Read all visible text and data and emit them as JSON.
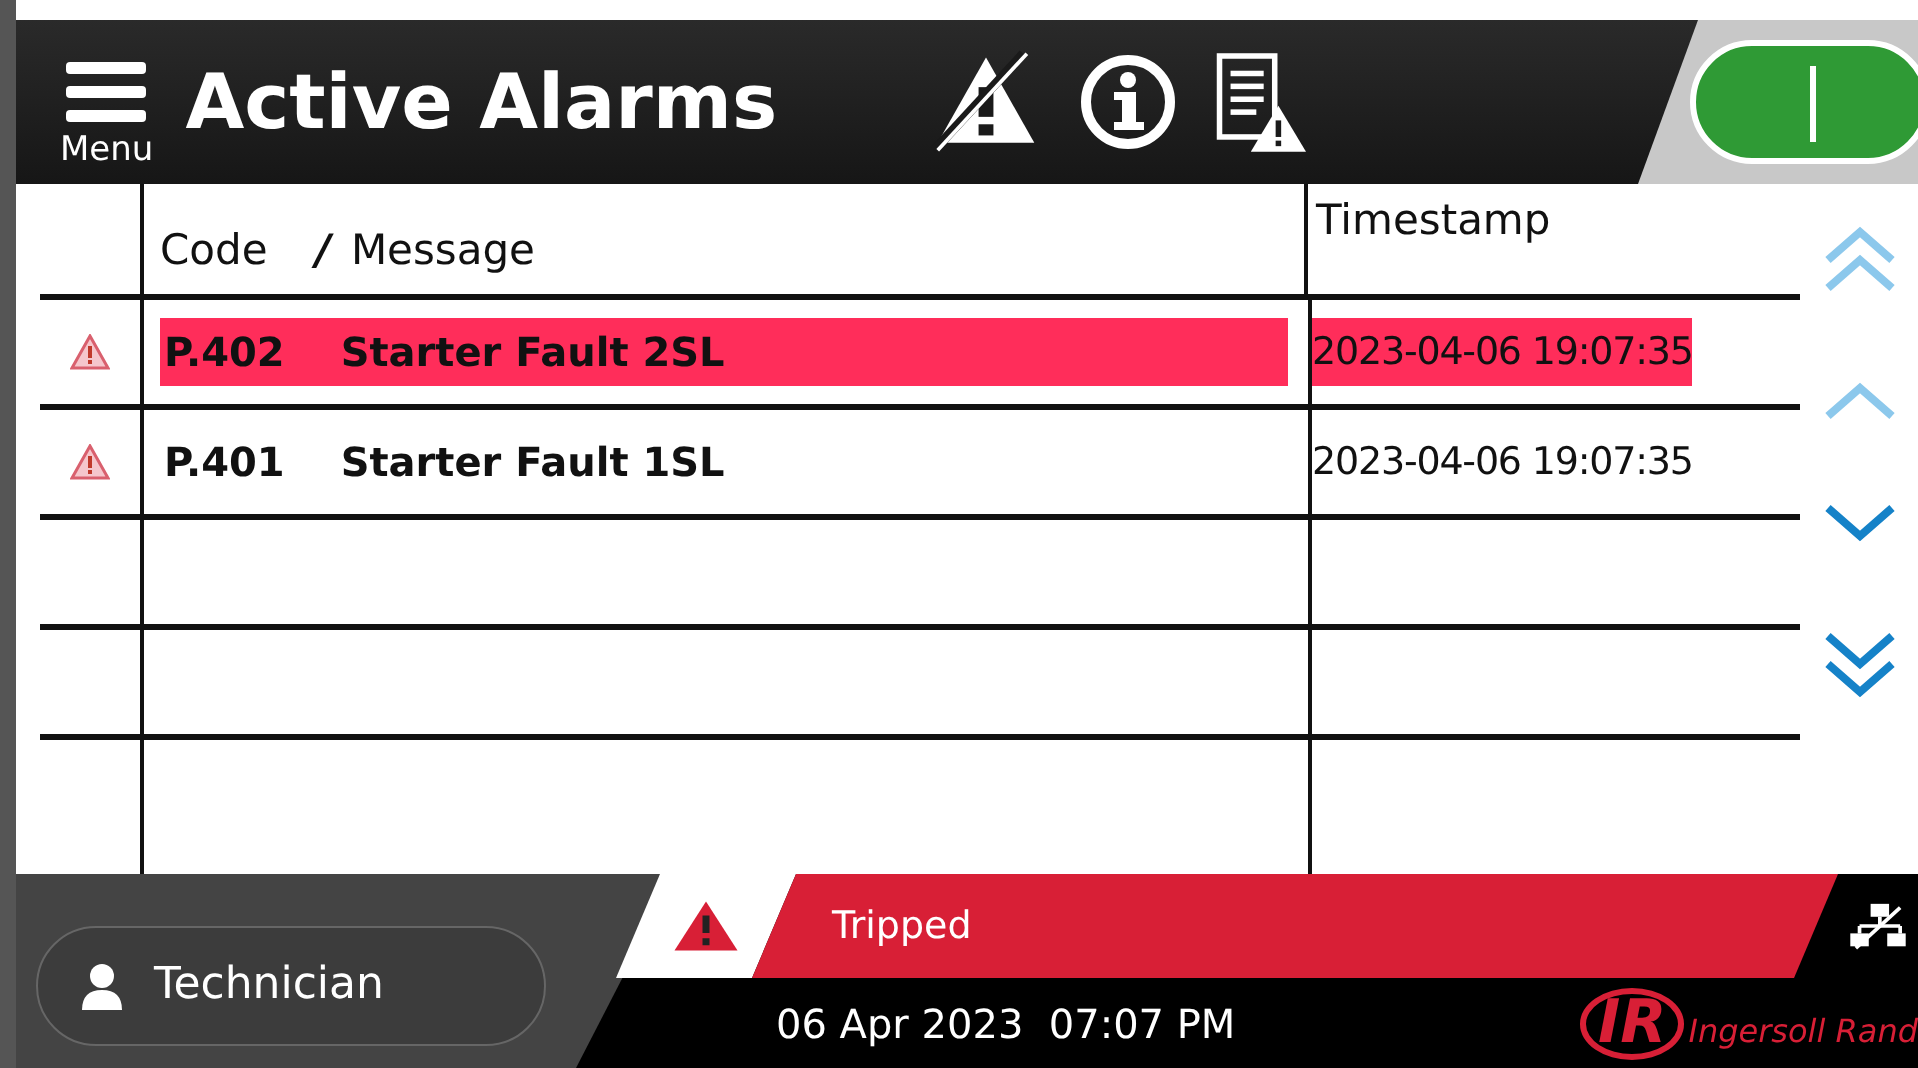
{
  "header": {
    "menu_label": "Menu",
    "title": "Active Alarms",
    "run_toggle": {
      "on": true
    }
  },
  "table": {
    "columns": {
      "code": "Code",
      "separator": "/",
      "message": "Message",
      "timestamp": "Timestamp"
    },
    "rows": [
      {
        "code": "P.402",
        "message": "Starter Fault 2SL",
        "timestamp": "2023-04-06 19:07:35",
        "selected": true
      },
      {
        "code": "P.401",
        "message": "Starter Fault 1SL",
        "timestamp": "2023-04-06 19:07:35",
        "selected": false
      }
    ]
  },
  "footer": {
    "user": "Technician",
    "status": "Tripped",
    "datetime": "06 Apr 2023  07:07 PM",
    "logo_mark": "IR",
    "logo_text": "Ingersoll Rand"
  }
}
